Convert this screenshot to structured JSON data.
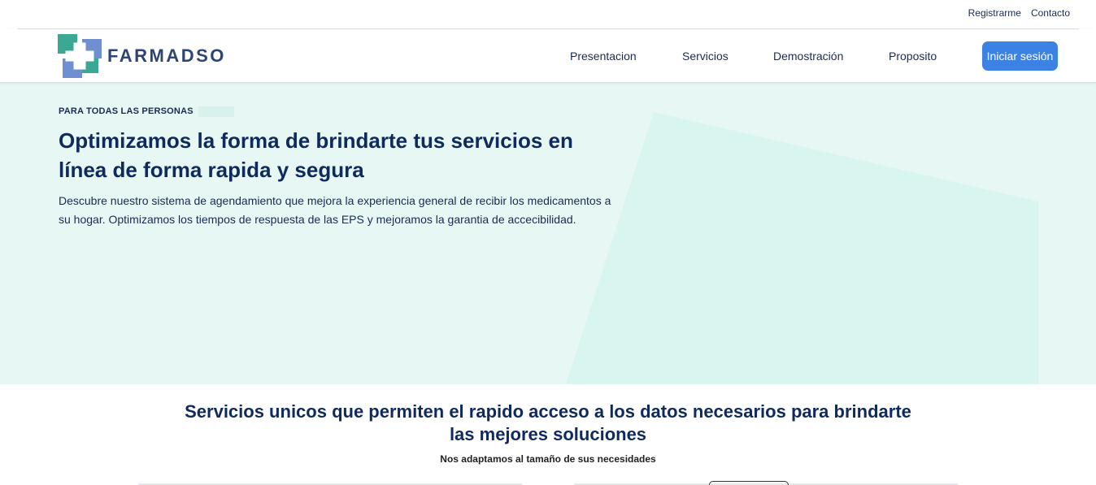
{
  "topbar": {
    "links": [
      "Registrarme",
      "Contacto"
    ]
  },
  "navbar": {
    "brand": "FARMADSO",
    "items": [
      "Presentacion",
      "Servicios",
      "Demostración",
      "Proposito"
    ],
    "login_label": "Iniciar sesión"
  },
  "hero": {
    "eyebrow": "PARA TODAS LAS PERSONAS",
    "title": "Optimizamos la forma de brindarte tus servicios en línea de forma rapida y segura",
    "description": "Descubre nuestro sistema de agendamiento que mejora la experiencia general de recibir los medicamentos a su hogar. Optimizamos los tiempos de respuesta de las EPS y mejoramos la garantia de accecibilidad."
  },
  "services": {
    "title": "Servicios unicos que permiten el rapido acceso a los datos necesarios para brindarte las mejores soluciones",
    "subtitle": "Nos adaptamos al tamaño de sus necesidades"
  },
  "colors": {
    "brand_navy": "#0f2a5c",
    "accent_blue": "#3b82e4",
    "hero_bg": "#e6f7f4",
    "logo_teal": "#3aa893",
    "logo_blue": "#6f8fd0"
  },
  "icons": {
    "logo": "medical-cross-logo-icon"
  }
}
